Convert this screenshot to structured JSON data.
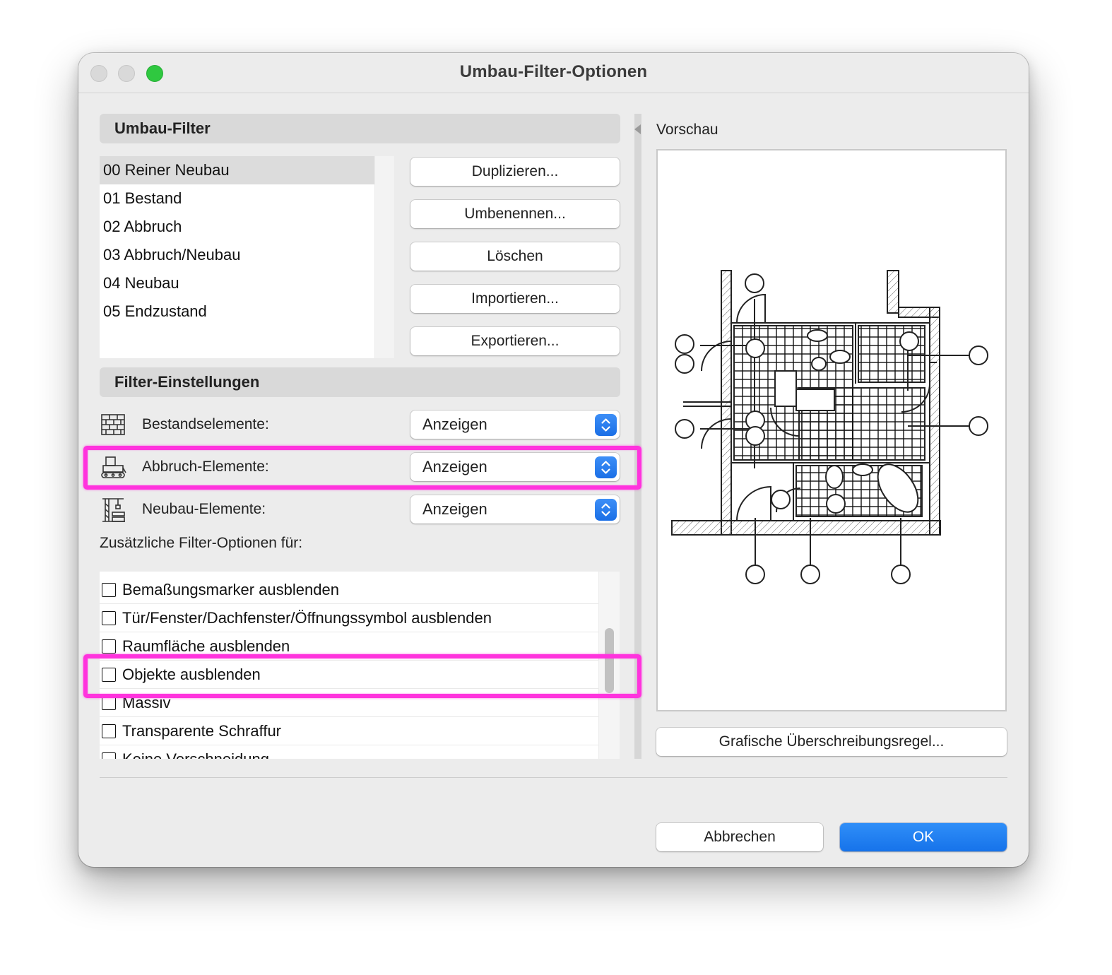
{
  "window": {
    "title": "Umbau-Filter-Optionen"
  },
  "filters": {
    "header": "Umbau-Filter",
    "items": [
      "00 Reiner Neubau",
      "01 Bestand",
      "02 Abbruch",
      "03 Abbruch/Neubau",
      "04 Neubau",
      "05 Endzustand"
    ],
    "selected": "00 Reiner Neubau",
    "buttons": {
      "duplicate": "Duplizieren...",
      "rename": "Umbenennen...",
      "delete": "Löschen",
      "import": "Importieren...",
      "export": "Exportieren..."
    }
  },
  "settings": {
    "header": "Filter-Einstellungen",
    "rows": [
      {
        "label": "Bestandselemente:",
        "value": "Anzeigen",
        "icon": "brick-wall-icon"
      },
      {
        "label": "Abbruch-Elemente:",
        "value": "Anzeigen",
        "icon": "bulldozer-icon"
      },
      {
        "label": "Neubau-Elemente:",
        "value": "Anzeigen",
        "icon": "crane-icon"
      }
    ],
    "extra_label": "Zusätzliche Filter-Optionen für:",
    "options": [
      {
        "label": "Bemaßungsmarker ausblenden",
        "checked": false
      },
      {
        "label": "Tür/Fenster/Dachfenster/Öffnungssymbol ausblenden",
        "checked": false
      },
      {
        "label": "Raumfläche ausblenden",
        "checked": false
      },
      {
        "label": "Objekte ausblenden",
        "checked": false
      },
      {
        "label": "Massiv",
        "checked": false
      },
      {
        "label": "Transparente Schraffur",
        "checked": false
      },
      {
        "label": "Keine Verschneidung",
        "checked": false
      }
    ]
  },
  "preview": {
    "label": "Vorschau",
    "override_button": "Grafische Überschreibungsregel..."
  },
  "footer": {
    "cancel": "Abbrechen",
    "ok": "OK"
  },
  "colors": {
    "accent": "#1a73e8",
    "highlight": "#ff33dd",
    "traffic_green": "#2fc840"
  }
}
